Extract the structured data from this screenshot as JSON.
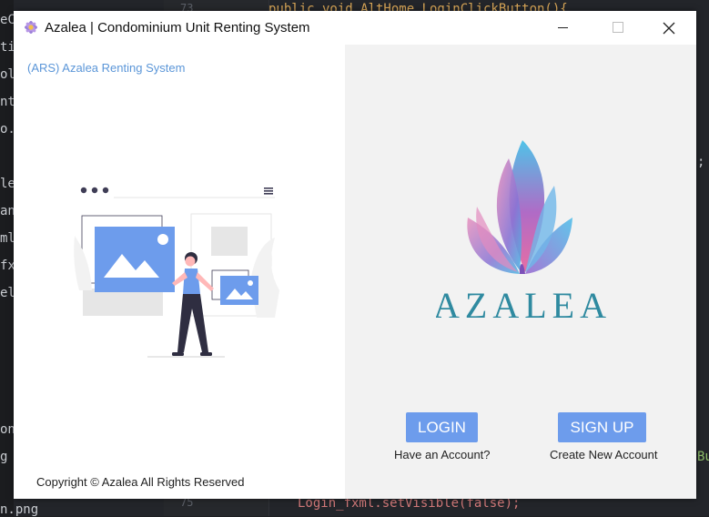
{
  "ide": {
    "sidebar_fragments": [
      "eC",
      "tio",
      "oli",
      "ntr",
      "o.j",
      "le",
      "an",
      "ml",
      "fx",
      "el",
      "on",
      "g",
      "n.png"
    ],
    "line_numbers": [
      "73",
      "75"
    ],
    "code_top": "public void AltHome_LoginClickButton(){",
    "code_semicolon": ";",
    "code_right": "Bu",
    "code_bottom": "Login_fxml.setVisible(false);"
  },
  "window": {
    "title": "Azalea | Condominium Unit Renting System",
    "brand_link": "(ARS) Azalea Renting System",
    "copyright": "Copyright © Azalea All Rights Reserved",
    "logo_text": "AZALEA",
    "login_label": "LOGIN",
    "login_caption": "Have an Account?",
    "signup_label": "SIGN UP",
    "signup_caption": "Create New Account"
  },
  "colors": {
    "accent_button": "#6d9cec",
    "link": "#5b96d8",
    "right_pane_bg": "#f2f2f2",
    "logo_text": "#2f8aa0"
  },
  "icons": [
    "flower-app-icon",
    "minimize-icon",
    "maximize-icon",
    "close-icon",
    "menu-icon",
    "image-placeholder-icon"
  ]
}
